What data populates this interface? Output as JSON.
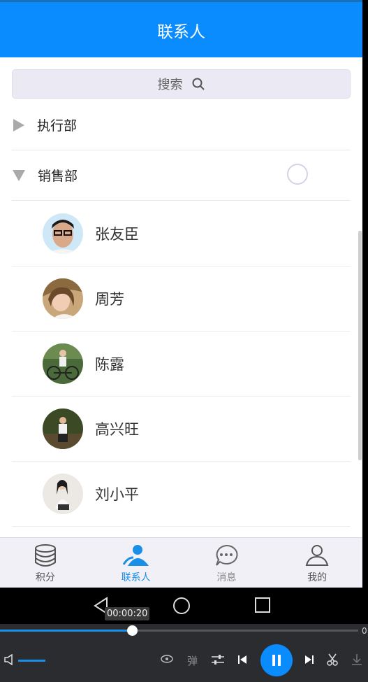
{
  "header": {
    "title": "联系人"
  },
  "search": {
    "label": "搜索"
  },
  "groups": [
    {
      "name": "执行部",
      "expanded": false
    },
    {
      "name": "销售部",
      "expanded": true
    }
  ],
  "contacts": [
    {
      "name": "张友臣"
    },
    {
      "name": "周芳"
    },
    {
      "name": "陈露"
    },
    {
      "name": "高兴旺"
    },
    {
      "name": "刘小平"
    }
  ],
  "tabbar": {
    "tabs": [
      {
        "label": "积分",
        "icon": "database-icon"
      },
      {
        "label": "联系人",
        "icon": "contacts-icon",
        "active": true
      },
      {
        "label": "消息",
        "icon": "chat-bubble-icon"
      },
      {
        "label": "我的",
        "icon": "user-icon"
      }
    ]
  },
  "player": {
    "current_time": "00:00:20",
    "end_time_visible": "0",
    "danmaku_label": "弹",
    "accent_color": "#0a8cff"
  }
}
